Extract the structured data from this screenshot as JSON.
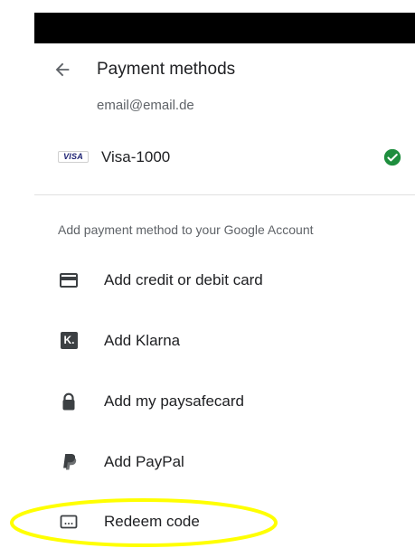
{
  "header": {
    "title": "Payment methods",
    "account_email": "email@email.de"
  },
  "saved_method": {
    "logo_text": "VISA",
    "label": "Visa-1000",
    "selected_icon": "check-circle-icon",
    "check_color": "#1e8e3e"
  },
  "section": {
    "label": "Add payment method to your Google Account"
  },
  "options": [
    {
      "icon": "credit-card-icon",
      "label": "Add credit or debit card"
    },
    {
      "icon": "klarna-icon",
      "label": "Add Klarna",
      "icon_glyph": "K."
    },
    {
      "icon": "lock-icon",
      "label": "Add my paysafecard"
    },
    {
      "icon": "paypal-icon",
      "label": "Add PayPal"
    },
    {
      "icon": "redeem-code-icon",
      "label": "Redeem code"
    }
  ],
  "annotation": {
    "highlight_color": "#ffff00"
  }
}
